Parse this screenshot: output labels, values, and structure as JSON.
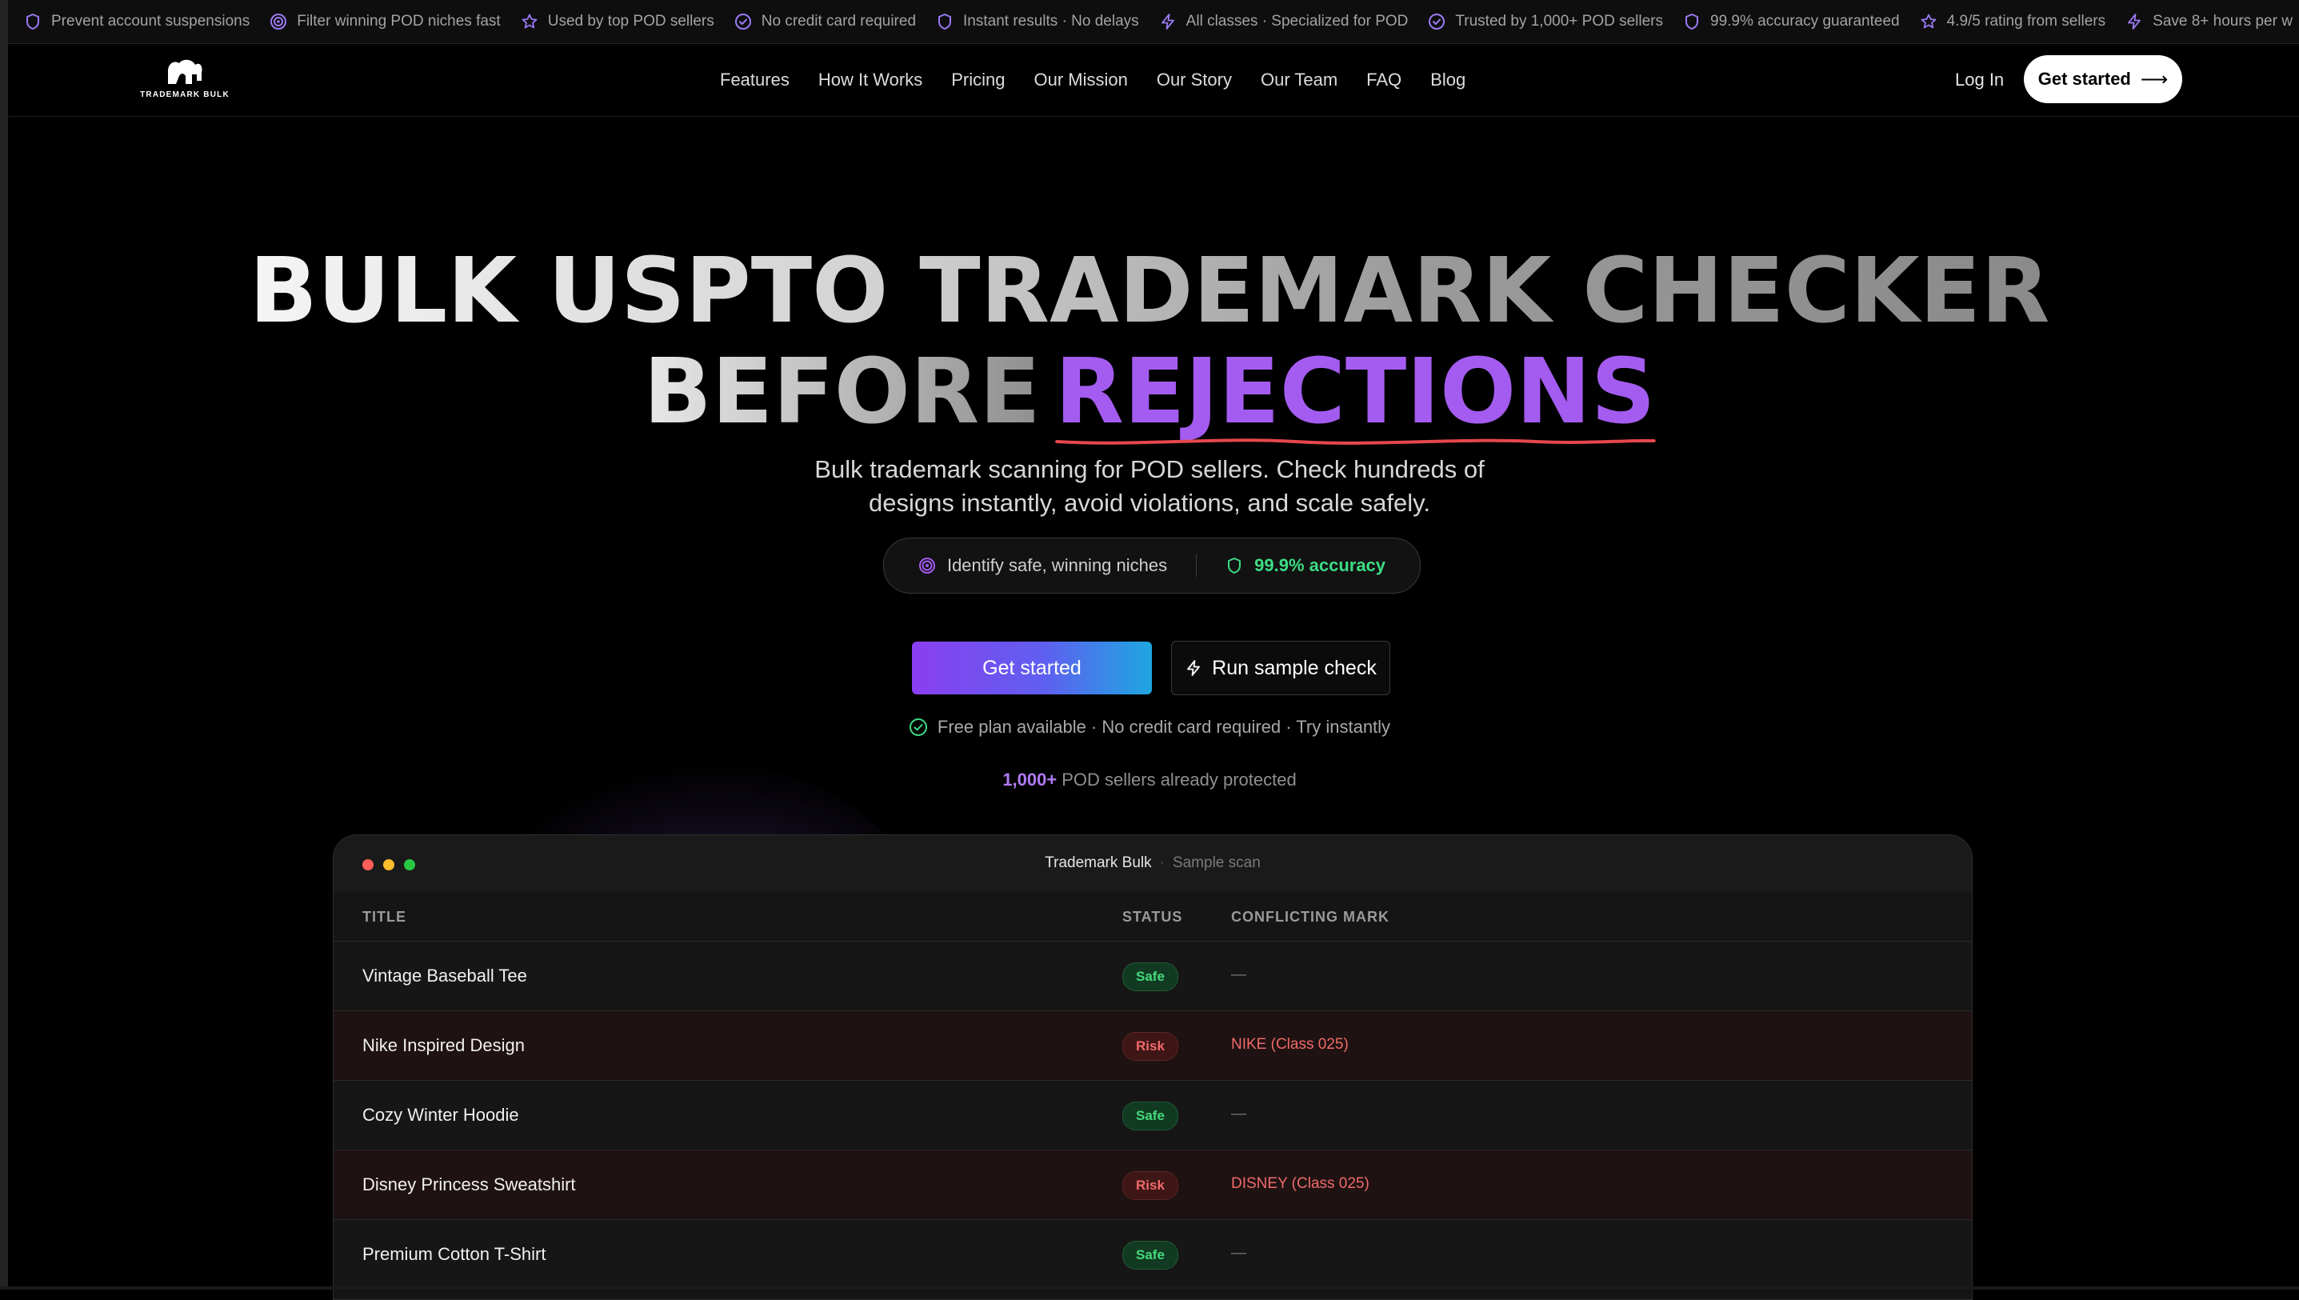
{
  "ticker": [
    {
      "icon": "shield-icon",
      "label": "Prevent account suspensions",
      "color": "#9b7af5"
    },
    {
      "icon": "target-icon",
      "label": "Filter winning POD niches fast",
      "color": "#9b7af5"
    },
    {
      "icon": "star-icon",
      "label": "Used by top POD sellers",
      "color": "#9b7af5"
    },
    {
      "icon": "check-circle-icon",
      "label": "No credit card required",
      "color": "#9b7af5"
    },
    {
      "icon": "shield-icon",
      "label": "Instant results · No delays",
      "color": "#9b7af5"
    },
    {
      "icon": "bolt-icon",
      "label": "All classes · Specialized for POD",
      "color": "#9b7af5"
    },
    {
      "icon": "check-circle-icon",
      "label": "Trusted by 1,000+ POD sellers",
      "color": "#9b7af5"
    },
    {
      "icon": "shield-icon",
      "label": "99.9% accuracy guaranteed",
      "color": "#9b7af5"
    },
    {
      "icon": "star-icon",
      "label": "4.9/5 rating from sellers",
      "color": "#9b7af5"
    },
    {
      "icon": "bolt-icon",
      "label": "Save 8+ hours per w",
      "color": "#9b7af5"
    }
  ],
  "nav": {
    "logo_text": "TRADEMARK BULK",
    "links": [
      "Features",
      "How It Works",
      "Pricing",
      "Our Mission",
      "Our Story",
      "Our Team",
      "FAQ",
      "Blog"
    ],
    "login": "Log In",
    "cta": "Get started",
    "cta_arrow": "⟶"
  },
  "hero": {
    "line1": "BULK USPTO TRADEMARK CHECKER",
    "line2_plain": "BEFORE",
    "line2_highlight": "REJECTIONS",
    "highlight_color": "#a45cf0",
    "underline_color": "#e5484d",
    "subtitle_1": "Bulk trademark scanning for POD sellers. Check hundreds of",
    "subtitle_2": "designs instantly, avoid violations, and scale safely.",
    "pill_left": "Identify safe, winning niches",
    "pill_right": "99.9% accuracy",
    "cta_primary": "Get started",
    "cta_secondary": "Run sample check",
    "free_plan": "Free plan available · No credit card required · Try instantly",
    "sellers_num": "1,000+",
    "sellers_text": "POD sellers already protected"
  },
  "panel": {
    "title": "Trademark Bulk",
    "sep": "·",
    "subtitle": "Sample scan",
    "columns": [
      "TITLE",
      "STATUS",
      "CONFLICTING MARK"
    ],
    "rows": [
      {
        "title": "Vintage Baseball Tee",
        "status": "Safe",
        "mark": "—"
      },
      {
        "title": "Nike Inspired Design",
        "status": "Risk",
        "mark": "NIKE (Class 025)"
      },
      {
        "title": "Cozy Winter Hoodie",
        "status": "Safe",
        "mark": "—"
      },
      {
        "title": "Disney Princess Sweatshirt",
        "status": "Risk",
        "mark": "DISNEY (Class 025)"
      },
      {
        "title": "Premium Cotton T-Shirt",
        "status": "Safe",
        "mark": "—"
      }
    ]
  }
}
